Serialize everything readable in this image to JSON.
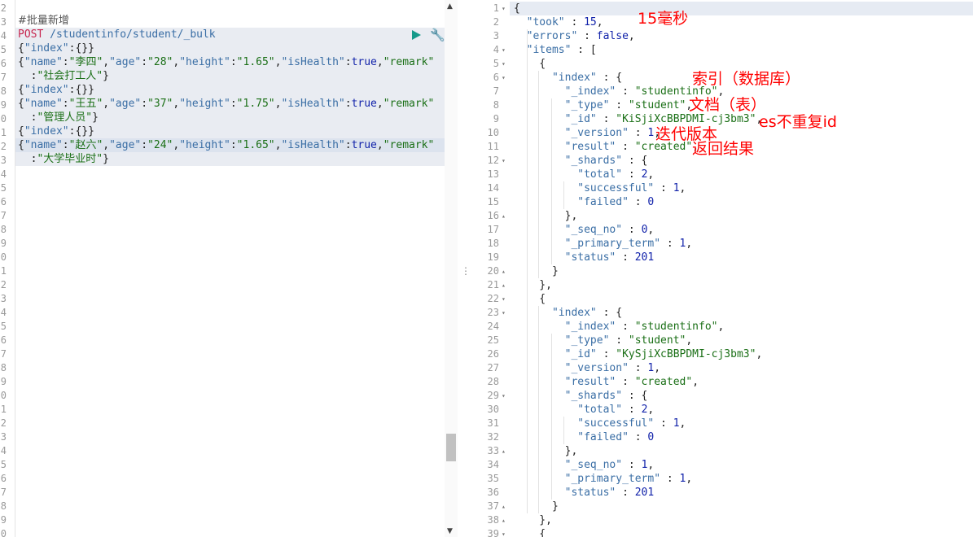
{
  "request": {
    "line_numbers": [
      "2",
      "3",
      "4",
      "5",
      "6",
      "7",
      "8",
      "9",
      "0",
      "1",
      "2",
      "3",
      "4",
      "5",
      "6",
      "7",
      "8",
      "9",
      "0",
      "1",
      "2",
      "3",
      "4",
      "5",
      "6",
      "7",
      "8",
      "9",
      "0",
      "1",
      "2",
      "3",
      "4",
      "5",
      "6",
      "7",
      "8",
      "9",
      "0"
    ],
    "comment": "#批量新增",
    "method": "POST",
    "url": "/studentinfo/student/_bulk",
    "body_lines": [
      "{\"index\":{}}",
      "{\"name\":\"李四\",\"age\":\"28\",\"height\":\"1.65\",\"isHealth\":true,\"remark\"",
      "  :\"社会打工人\"}",
      "{\"index\":{}}",
      "{\"name\":\"王五\",\"age\":\"37\",\"height\":\"1.75\",\"isHealth\":true,\"remark\"",
      "  :\"管理人员\"}",
      "{\"index\":{}}",
      "{\"name\":\"赵六\",\"age\":\"24\",\"height\":\"1.65\",\"isHealth\":true,\"remark\"",
      "  :\"大学毕业时\"}"
    ],
    "run_icon": "play-icon",
    "settings_icon": "wrench-icon"
  },
  "response": {
    "lines": [
      {
        "n": "1",
        "fold": "▾",
        "text": "{"
      },
      {
        "n": "2",
        "fold": "",
        "text": "  \"took\" : 15,"
      },
      {
        "n": "3",
        "fold": "",
        "text": "  \"errors\" : false,"
      },
      {
        "n": "4",
        "fold": "▾",
        "text": "  \"items\" : ["
      },
      {
        "n": "5",
        "fold": "▾",
        "text": "    {"
      },
      {
        "n": "6",
        "fold": "▾",
        "text": "      \"index\" : {"
      },
      {
        "n": "7",
        "fold": "",
        "text": "        \"_index\" : \"studentinfo\","
      },
      {
        "n": "8",
        "fold": "",
        "text": "        \"_type\" : \"student\","
      },
      {
        "n": "9",
        "fold": "",
        "text": "        \"_id\" : \"KiSjiXcBBPDMI-cj3bm3\","
      },
      {
        "n": "10",
        "fold": "",
        "text": "        \"_version\" : 1,"
      },
      {
        "n": "11",
        "fold": "",
        "text": "        \"result\" : \"created\","
      },
      {
        "n": "12",
        "fold": "▾",
        "text": "        \"_shards\" : {"
      },
      {
        "n": "13",
        "fold": "",
        "text": "          \"total\" : 2,"
      },
      {
        "n": "14",
        "fold": "",
        "text": "          \"successful\" : 1,"
      },
      {
        "n": "15",
        "fold": "",
        "text": "          \"failed\" : 0"
      },
      {
        "n": "16",
        "fold": "▴",
        "text": "        },"
      },
      {
        "n": "17",
        "fold": "",
        "text": "        \"_seq_no\" : 0,"
      },
      {
        "n": "18",
        "fold": "",
        "text": "        \"_primary_term\" : 1,"
      },
      {
        "n": "19",
        "fold": "",
        "text": "        \"status\" : 201"
      },
      {
        "n": "20",
        "fold": "▴",
        "text": "      }"
      },
      {
        "n": "21",
        "fold": "▴",
        "text": "    },"
      },
      {
        "n": "22",
        "fold": "▾",
        "text": "    {"
      },
      {
        "n": "23",
        "fold": "▾",
        "text": "      \"index\" : {"
      },
      {
        "n": "24",
        "fold": "",
        "text": "        \"_index\" : \"studentinfo\","
      },
      {
        "n": "25",
        "fold": "",
        "text": "        \"_type\" : \"student\","
      },
      {
        "n": "26",
        "fold": "",
        "text": "        \"_id\" : \"KySjiXcBBPDMI-cj3bm3\","
      },
      {
        "n": "27",
        "fold": "",
        "text": "        \"_version\" : 1,"
      },
      {
        "n": "28",
        "fold": "",
        "text": "        \"result\" : \"created\","
      },
      {
        "n": "29",
        "fold": "▾",
        "text": "        \"_shards\" : {"
      },
      {
        "n": "30",
        "fold": "",
        "text": "          \"total\" : 2,"
      },
      {
        "n": "31",
        "fold": "",
        "text": "          \"successful\" : 1,"
      },
      {
        "n": "32",
        "fold": "",
        "text": "          \"failed\" : 0"
      },
      {
        "n": "33",
        "fold": "▴",
        "text": "        },"
      },
      {
        "n": "34",
        "fold": "",
        "text": "        \"_seq_no\" : 1,"
      },
      {
        "n": "35",
        "fold": "",
        "text": "        \"_primary_term\" : 1,"
      },
      {
        "n": "36",
        "fold": "",
        "text": "        \"status\" : 201"
      },
      {
        "n": "37",
        "fold": "▴",
        "text": "      }"
      },
      {
        "n": "38",
        "fold": "▴",
        "text": "    },"
      },
      {
        "n": "39",
        "fold": "▾",
        "text": "    {"
      }
    ]
  },
  "annotations": {
    "took": "15毫秒",
    "index": "索引（数据库）",
    "type": "文档（表）",
    "id": "es不重复id",
    "version": "迭代版本",
    "result": "返回结果"
  },
  "splitter_icon": "drag-handle-icon"
}
